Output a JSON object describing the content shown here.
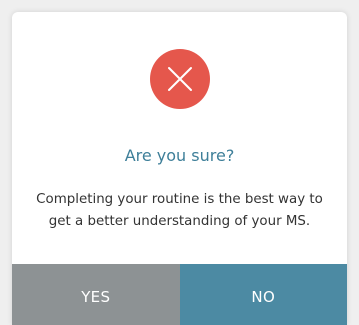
{
  "dialog": {
    "icon": "close-icon",
    "title": "Are you sure?",
    "message_line1": "Completing your routine is the best way to",
    "message_line2": "get a better understanding of your MS.",
    "yes_label": "YES",
    "no_label": "NO"
  },
  "colors": {
    "icon_circle": "#e5574c",
    "title": "#3e7f99",
    "yes_button": "#8d9294",
    "no_button": "#4c8aa3"
  }
}
